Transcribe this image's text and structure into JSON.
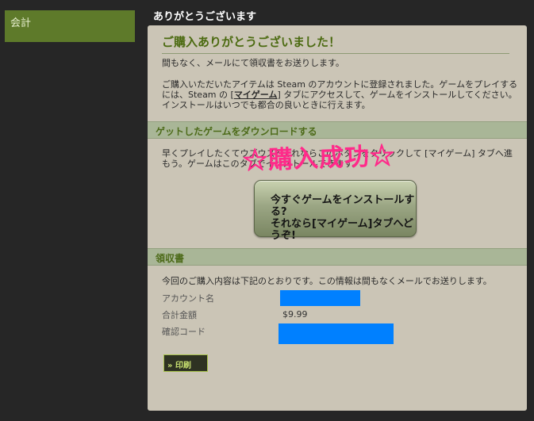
{
  "sidebar": {
    "tab_label": "会計"
  },
  "header": {
    "title": "ありがとうございます"
  },
  "main": {
    "thanks_title": "ご購入ありがとうございました！",
    "email_notice": "間もなく、メールにて領収書をお送りします。",
    "registered_text_pre": "ご購入いただいたアイテムは Steam のアカウントに登録されました。ゲームをプレイするには、Steam の [",
    "mygame_link": "マイゲーム",
    "registered_text_post": "] タブにアクセスして、ゲームをインストールしてください。インストールはいつでも都合の良いときに行えます。",
    "download_section": {
      "title": "ゲットしたゲームをダウンロードする",
      "text": "早くプレイしたくてウズウズ? それならこのボタンをクリックして [マイゲーム] タブへ進もう。ゲームはこのタブでインストールできます。",
      "install_button_label": "今すぐゲームをインストールする?\nそれなら[マイゲーム]タブへどうぞ!"
    },
    "overlay_text": "☆購入成功☆",
    "receipt_section": {
      "title": "領収書",
      "text": "今回のご購入内容は下記のとおりです。この情報は間もなくメールでお送りします。",
      "rows": [
        {
          "label": "アカウント名",
          "value": ""
        },
        {
          "label": "合計金額",
          "value": "$9.99"
        },
        {
          "label": "確認コード",
          "value": ""
        }
      ]
    },
    "print_button_label": "» 印刷"
  },
  "colors": {
    "background": "#262626",
    "panel": "#cbc5b6",
    "accent_green": "#4b6a10",
    "section_bar": "#a9b697",
    "redaction": "#0080ff",
    "overlay_pink": "#ff2a8a"
  }
}
